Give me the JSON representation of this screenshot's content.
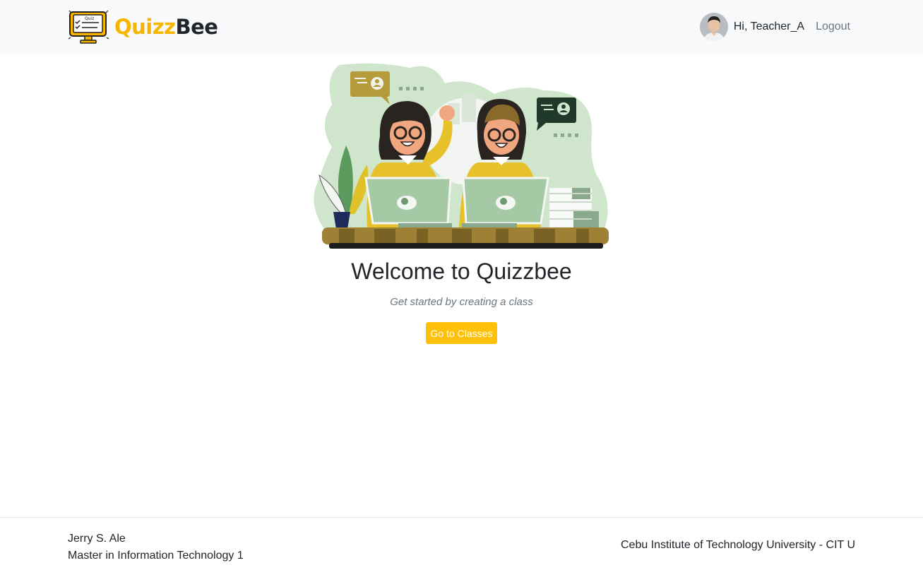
{
  "navbar": {
    "brand": {
      "part1": "Quizz",
      "part2": "Bee"
    },
    "greeting": "Hi, Teacher_A",
    "logout_label": "Logout"
  },
  "hero": {
    "title": "Welcome to Quizzbee",
    "subtitle": "Get started by creating a class",
    "cta_label": "Go to Classes"
  },
  "footer": {
    "name": "Jerry S. Ale",
    "program": "Master in Information Technology 1",
    "institution": "Cebu Institute of Technology University - CIT U"
  },
  "colors": {
    "accent": "#ffc107",
    "brand_yellow": "#f7b500",
    "navbar_bg": "#f8f9fa",
    "illustration_green": "#cfe6cd"
  },
  "icons": {
    "brand_logo": "quiz-monitor-icon",
    "avatar": "user-avatar-photo"
  }
}
